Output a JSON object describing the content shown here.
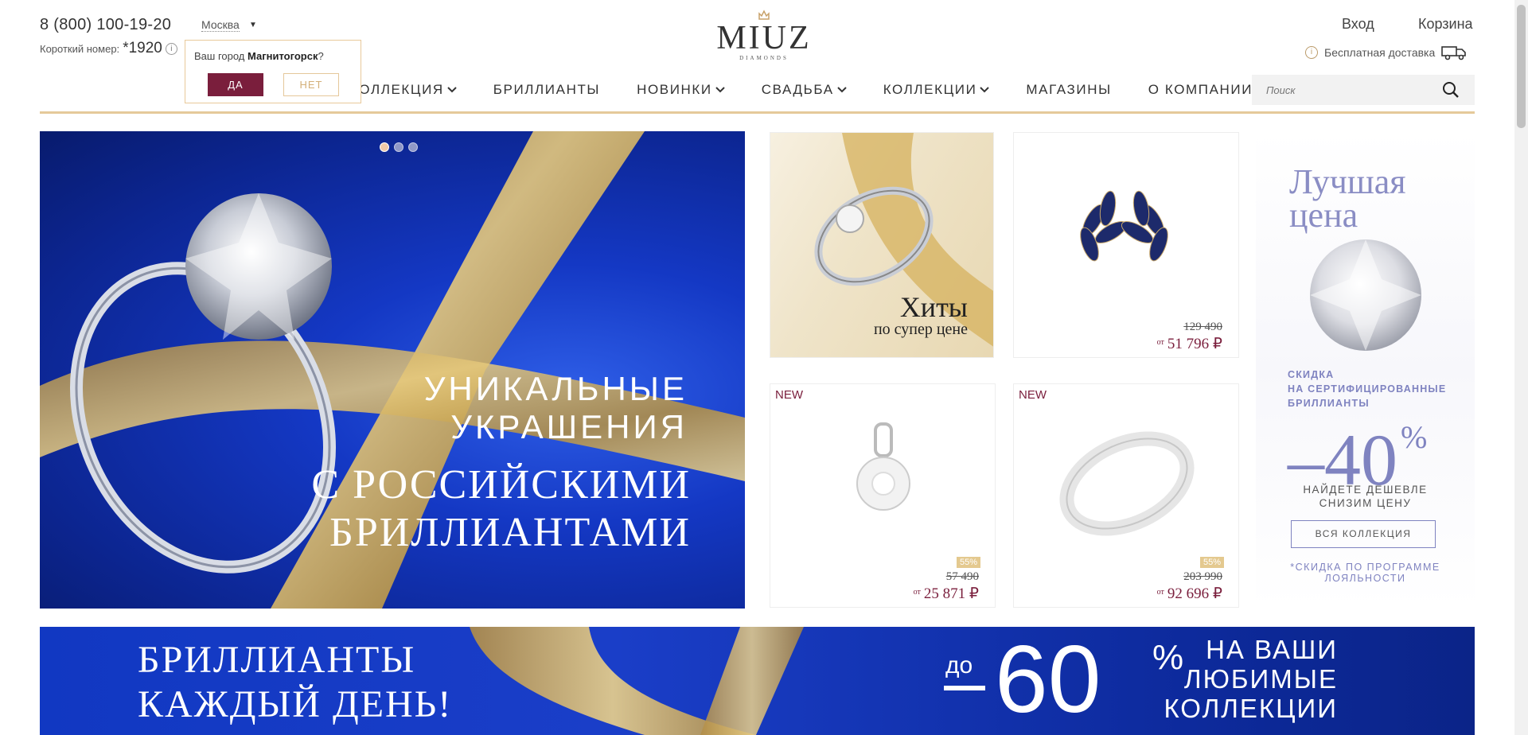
{
  "header": {
    "phone": "8 (800) 100-19-20",
    "short_number_label": "Короткий номер:",
    "short_number": "*1920",
    "info_icon": "i",
    "city": "Москва",
    "logo_text": "MIUZ",
    "logo_sub": "DIAMONDS",
    "login": "Вход",
    "cart": "Корзина",
    "delivery": "Бесплатная доставка",
    "search_placeholder": "Поиск"
  },
  "nav": [
    {
      "label": "КОЛЛЕКЦИЯ",
      "chevron": true
    },
    {
      "label": "БРИЛЛИАНТЫ",
      "chevron": false
    },
    {
      "label": "НОВИНКИ",
      "chevron": true
    },
    {
      "label": "СВАДЬБА",
      "chevron": true
    },
    {
      "label": "КОЛЛЕКЦИИ",
      "chevron": true
    },
    {
      "label": "МАГАЗИНЫ",
      "chevron": false
    },
    {
      "label": "О КОМПАНИИ",
      "chevron": true
    }
  ],
  "popup": {
    "question_prefix": "Ваш город ",
    "city": "Магнитогорск",
    "question_suffix": "?",
    "yes": "ДА",
    "no": "НЕТ"
  },
  "hero": {
    "line1": "УНИКАЛЬНЫЕ",
    "line2": "УКРАШЕНИЯ",
    "line3": "С РОССИЙСКИМИ",
    "line4": "БРИЛЛИАНТАМИ",
    "slides": 3,
    "active_slide": 1
  },
  "tiles": {
    "hits": {
      "title": "Хиты",
      "subtitle": "по супер цене"
    },
    "earrings": {
      "old_price": "129 490",
      "price_prefix": "от",
      "price": "51 796 ₽"
    },
    "pendant": {
      "tag": "NEW",
      "discount": "55%",
      "old_price": "57 490",
      "price_prefix": "от",
      "price": "25 871 ₽"
    },
    "ring": {
      "tag": "NEW",
      "discount": "55%",
      "old_price": "203 990",
      "price_prefix": "от",
      "price": "92 696 ₽"
    }
  },
  "side_promo": {
    "title_line1": "Лучшая",
    "title_line2": "цена",
    "label_line1": "СКИДКА",
    "label_line2": "НА СЕРТИФИЦИРОВАННЫЕ",
    "label_line3": "БРИЛЛИАНТЫ",
    "percent": "–40",
    "percent_sign": "%",
    "cheaper_line1": "НАЙДЕТЕ ДЕШЕВЛЕ",
    "cheaper_line2": "СНИЗИМ ЦЕНУ",
    "button": "ВСЯ КОЛЛЕКЦИЯ",
    "note_line1": "*СКИДКА ПО ПРОГРАММЕ",
    "note_line2": "ЛОЯЛЬНОСТИ"
  },
  "banner2": {
    "line1": "БРИЛЛИАНТЫ",
    "line2": "КАЖДЫЙ ДЕНЬ!",
    "prefix": "до",
    "number": "60",
    "percent": "%",
    "text_line1": "НА ВАШИ",
    "text_line2": "ЛЮБИМЫЕ",
    "text_line3": "КОЛЛЕКЦИИ"
  },
  "colors": {
    "brand": "#7a1e3c",
    "gold": "#e5c99a",
    "hero_blue": "#1438c4",
    "promo_violet": "#7f83c0"
  }
}
